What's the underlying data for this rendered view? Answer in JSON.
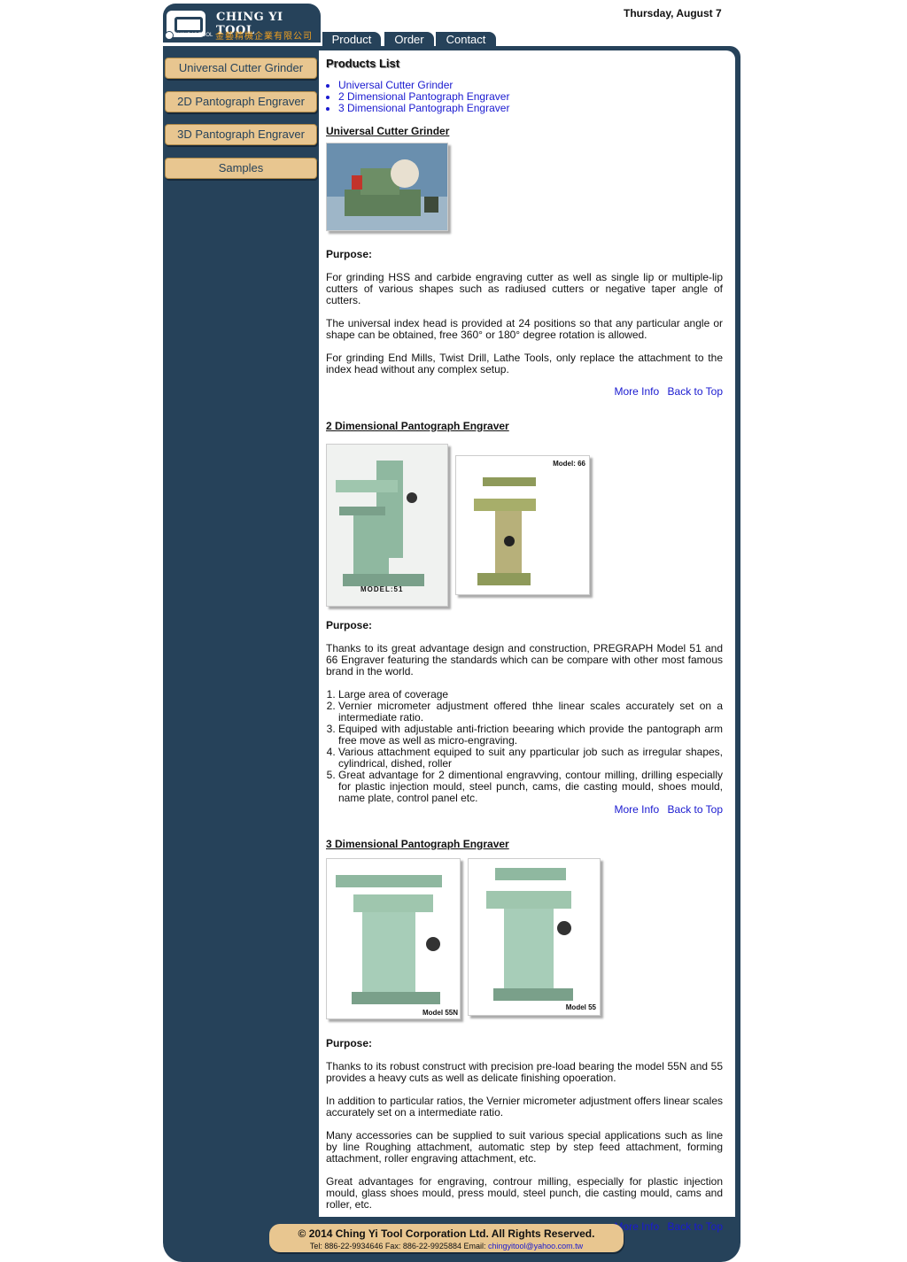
{
  "brand": {
    "name_en": "CHING YI TOOL",
    "name_small": "CHING YI TOOL",
    "name_zh": "金藝精機企業有限公司"
  },
  "date": "Thursday, August 7",
  "tabs": [
    "Product",
    "Order",
    "Contact"
  ],
  "sidebar": [
    "Universal Cutter Grinder",
    "2D Pantograph Engraver",
    "3D Pantograph Engraver",
    "Samples"
  ],
  "products_heading": "Products List",
  "products_list": [
    "Universal Cutter Grinder",
    "2 Dimensional Pantograph Engraver",
    "3 Dimensional Pantograph Engraver"
  ],
  "sections": [
    {
      "title": "Universal Cutter Grinder",
      "purpose_label": "Purpose:",
      "paragraphs": [
        "For grinding HSS and carbide engraving cutter as well as single lip or multiple-lip cutters of various shapes such as radiused cutters or negative taper angle of cutters.",
        "The universal index head is provided at 24 positions so that any particular angle or shape can be obtained, free 360° or 180° degree rotation is allowed.",
        "For grinding End Mills, Twist Drill, Lathe Tools, only replace the attachment to the index head without any complex setup."
      ],
      "more_info": "More Info",
      "back_top": "Back to Top"
    },
    {
      "title": "2 Dimensional Pantograph Engraver",
      "image_labels": [
        "MODEL:51",
        "Model: 66"
      ],
      "purpose_label": "Purpose:",
      "paragraphs": [
        "Thanks to its great advantage design and construction, PREGRAPH Model 51 and 66 Engraver featuring the standards which can be compare with other most famous brand in the world."
      ],
      "features": [
        "Large area of coverage",
        "Vernier micrometer adjustment offered thhe linear scales accurately set on a intermediate ratio.",
        "Equiped with adjustable anti-friction beearing which provide the pantograph arm free move as well as micro-engraving.",
        "Various attachment equiped to suit any pparticular job such as irregular shapes, cylindrical, dished, roller",
        "Great advantage for 2 dimentional engravving, contour milling, drilling especially for plastic injection mould, steel punch, cams, die casting mould, shoes mould, name plate, control panel etc."
      ],
      "more_info": "More Info",
      "back_top": "Back to Top"
    },
    {
      "title": "3 Dimensional Pantograph Engraver",
      "image_labels": [
        "Model 55N",
        "Model 55"
      ],
      "purpose_label": "Purpose:",
      "paragraphs": [
        "Thanks to its robust construct with precision pre-load bearing the model 55N and 55 provides a heavy cuts as well as delicate finishing opoeration.",
        "In addition to particular ratios, the Vernier micrometer adjustment offers linear scales accurately set on a intermediate ratio.",
        "Many accessories can be supplied to suit various special applications such as line by line Roughing attachment, automatic step by step feed attachment, forming attachment, roller engraving attachment, etc.",
        "Great advantages for engraving, controur milling, especially for plastic injection mould, glass shoes mould, press mould, steel punch, die casting mould, cams and roller, etc."
      ],
      "more_info": "More Info",
      "back_top": "Back to Top"
    }
  ],
  "footer": {
    "copyright": "© 2014 Ching Yi Tool Corporation Ltd. All Rights Reserved.",
    "contact_prefix": "Tel: 886-22-9934646 Fax: 886-22-9925884 Email:",
    "email": "chingyitool@yahoo.com.tw"
  },
  "colors": {
    "navy": "#26425a",
    "tan": "#e8c690",
    "link": "#1a1ad0",
    "machine_green": "#8fb8a0"
  }
}
